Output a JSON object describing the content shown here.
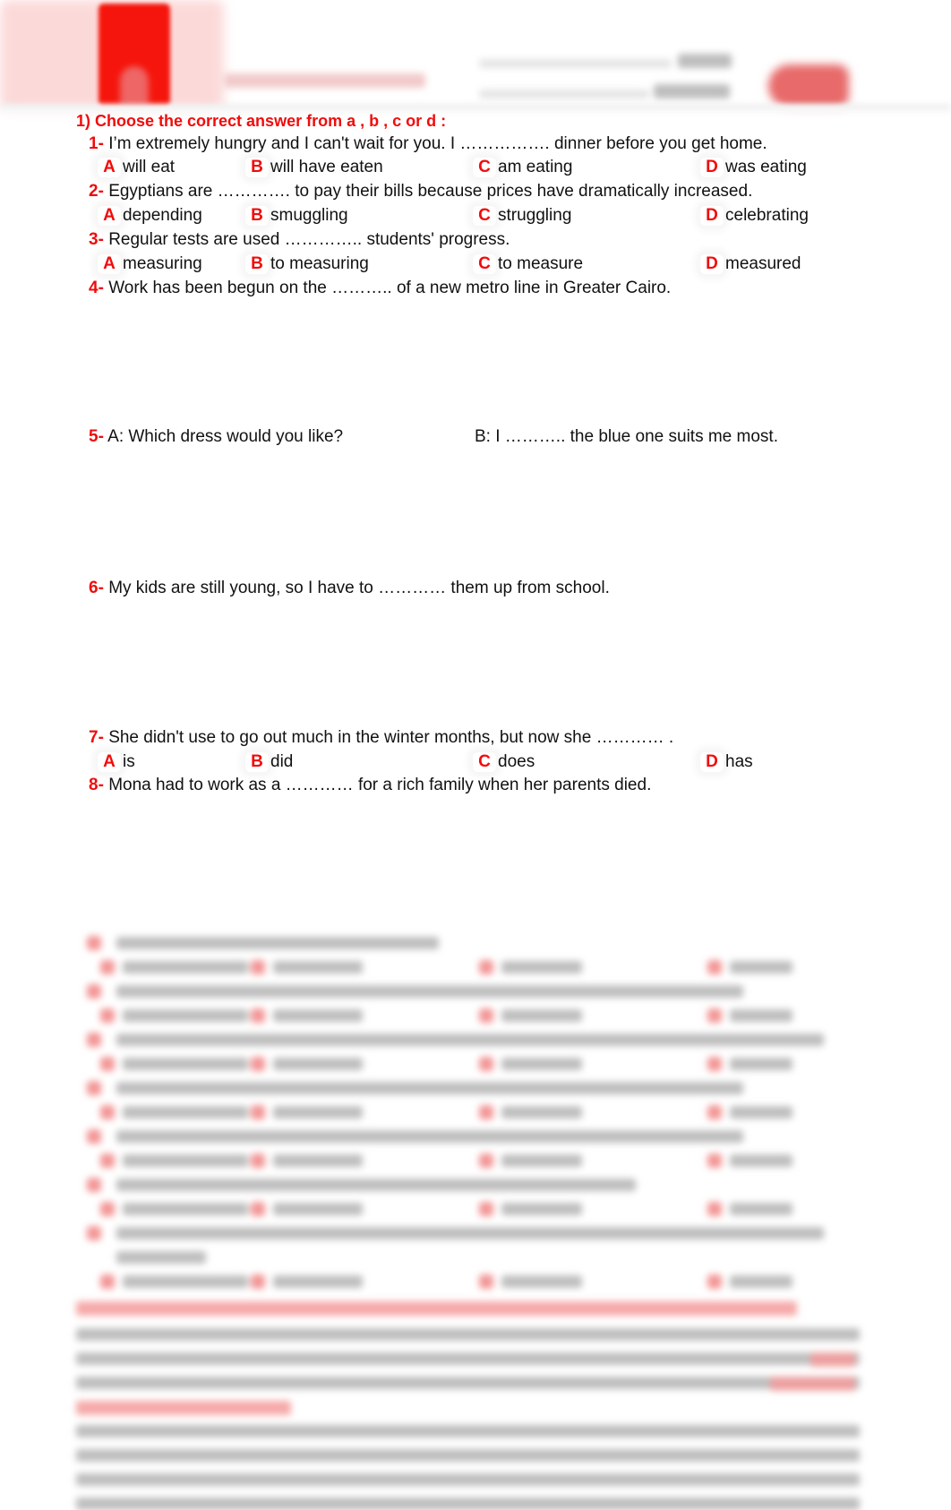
{
  "header": {
    "logo_icon": "bookmark-logo",
    "subtitle_blurred": true,
    "fields_blurred": true,
    "stamp_icon": "brand-stamp"
  },
  "section1": {
    "heading": "1) Choose the correct answer from a , b , c or d :",
    "questions": [
      {
        "num": "1-",
        "text": "I’m extremely hungry and I can't wait for you. I ……………. dinner before you get home.",
        "options": [
          {
            "letter": "A",
            "text": "will eat"
          },
          {
            "letter": "B",
            "text": "will have eaten"
          },
          {
            "letter": "C",
            "text": "am eating"
          },
          {
            "letter": "D",
            "text": "was eating"
          }
        ]
      },
      {
        "num": "2-",
        "text": "Egyptians are …………. to pay their bills because prices have dramatically increased.",
        "options": [
          {
            "letter": "A",
            "text": "depending"
          },
          {
            "letter": "B",
            "text": "smuggling"
          },
          {
            "letter": "C",
            "text": "struggling"
          },
          {
            "letter": "D",
            "text": "celebrating"
          }
        ]
      },
      {
        "num": "3-",
        "text": "Regular tests are used ………….. students' progress.",
        "options": [
          {
            "letter": "A",
            "text": "measuring"
          },
          {
            "letter": "B",
            "text": "to measuring"
          },
          {
            "letter": "C",
            "text": "to measure"
          },
          {
            "letter": "D",
            "text": "measured"
          }
        ]
      },
      {
        "num": "4-",
        "text": "Work has been begun on the ……….. of a new metro line in Greater Cairo."
      },
      {
        "num": "5-",
        "text": "A: Which dress would you like?",
        "text_b": "B: I ……….. the blue one suits me most."
      },
      {
        "num": "6-",
        "text": "My kids are still young, so I have to ………… them up from school."
      },
      {
        "num": "7-",
        "text": "She didn't use to go out much in the winter months, but now she ………… .",
        "options": [
          {
            "letter": "A",
            "text": "is"
          },
          {
            "letter": "B",
            "text": "did"
          },
          {
            "letter": "C",
            "text": "does"
          },
          {
            "letter": "D",
            "text": "has"
          }
        ]
      },
      {
        "num": "8-",
        "text": "Mona had to work as a ………… for a rich family when her parents died."
      }
    ]
  },
  "blurred_preview": {
    "note_visible": false
  },
  "colors": {
    "accent_red": "#f00c0c",
    "text": "#111111"
  }
}
